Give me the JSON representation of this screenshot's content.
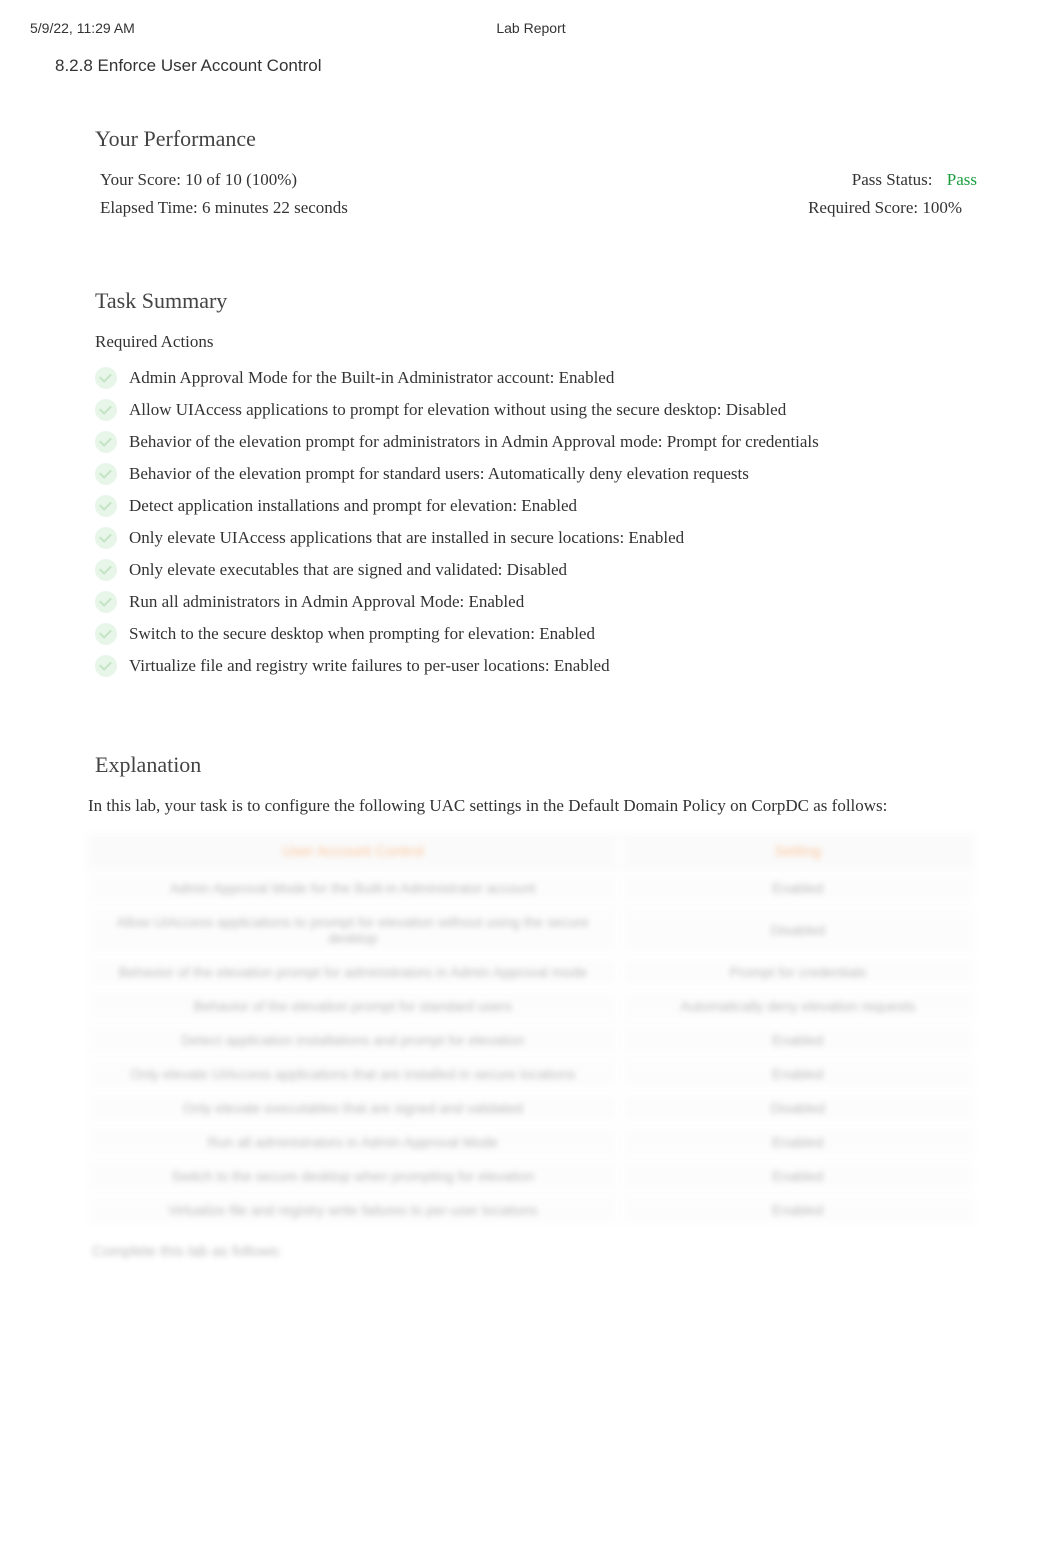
{
  "header": {
    "timestamp": "5/9/22, 11:29 AM",
    "title": "Lab Report"
  },
  "section_title": "8.2.8 Enforce User Account Control",
  "performance": {
    "heading": "Your Performance",
    "score_label": "Your Score: 10 of 10 (100%)",
    "pass_status_label": "Pass Status:",
    "pass_status_value": "Pass",
    "elapsed_time": "Elapsed Time: 6 minutes 22 seconds",
    "required_score": "Required Score: 100%"
  },
  "task_summary": {
    "heading": "Task Summary",
    "subheading": "Required Actions",
    "actions": [
      "Admin Approval Mode for the Built-in Administrator account: Enabled",
      "Allow UIAccess applications to prompt for elevation without using the secure desktop: Disabled",
      "Behavior of the elevation prompt for administrators in Admin Approval mode: Prompt for credentials",
      "Behavior of the elevation prompt for standard users: Automatically deny elevation requests",
      "Detect application installations and prompt for elevation: Enabled",
      "Only elevate UIAccess applications that are installed in secure locations: Enabled",
      "Only elevate executables that are signed and validated: Disabled",
      "Run all administrators in Admin Approval Mode: Enabled",
      "Switch to the secure desktop when prompting for elevation: Enabled",
      "Virtualize file and registry write failures to per-user locations: Enabled"
    ]
  },
  "explanation": {
    "heading": "Explanation",
    "intro": "In this lab, your task is to configure the following UAC settings in the Default Domain Policy on CorpDC as follows:",
    "table": {
      "headers": [
        "User Account Control",
        "Setting"
      ],
      "rows": [
        [
          "Admin Approval Mode for the Built-in Administrator account",
          "Enabled"
        ],
        [
          "Allow UIAccess applications to prompt for elevation without using the secure desktop",
          "Disabled"
        ],
        [
          "Behavior of the elevation prompt for administrators in Admin Approval mode",
          "Prompt for credentials"
        ],
        [
          "Behavior of the elevation prompt for standard users",
          "Automatically deny elevation requests"
        ],
        [
          "Detect application installations and prompt for elevation",
          "Enabled"
        ],
        [
          "Only elevate UIAccess applications that are installed in secure locations",
          "Enabled"
        ],
        [
          "Only elevate executables that are signed and validated",
          "Disabled"
        ],
        [
          "Run all administrators in Admin Approval Mode",
          "Enabled"
        ],
        [
          "Switch to the secure desktop when prompting for elevation",
          "Enabled"
        ],
        [
          "Virtualize file and registry write failures to per-user locations",
          "Enabled"
        ]
      ]
    },
    "footer": "Complete this lab as follows:"
  }
}
